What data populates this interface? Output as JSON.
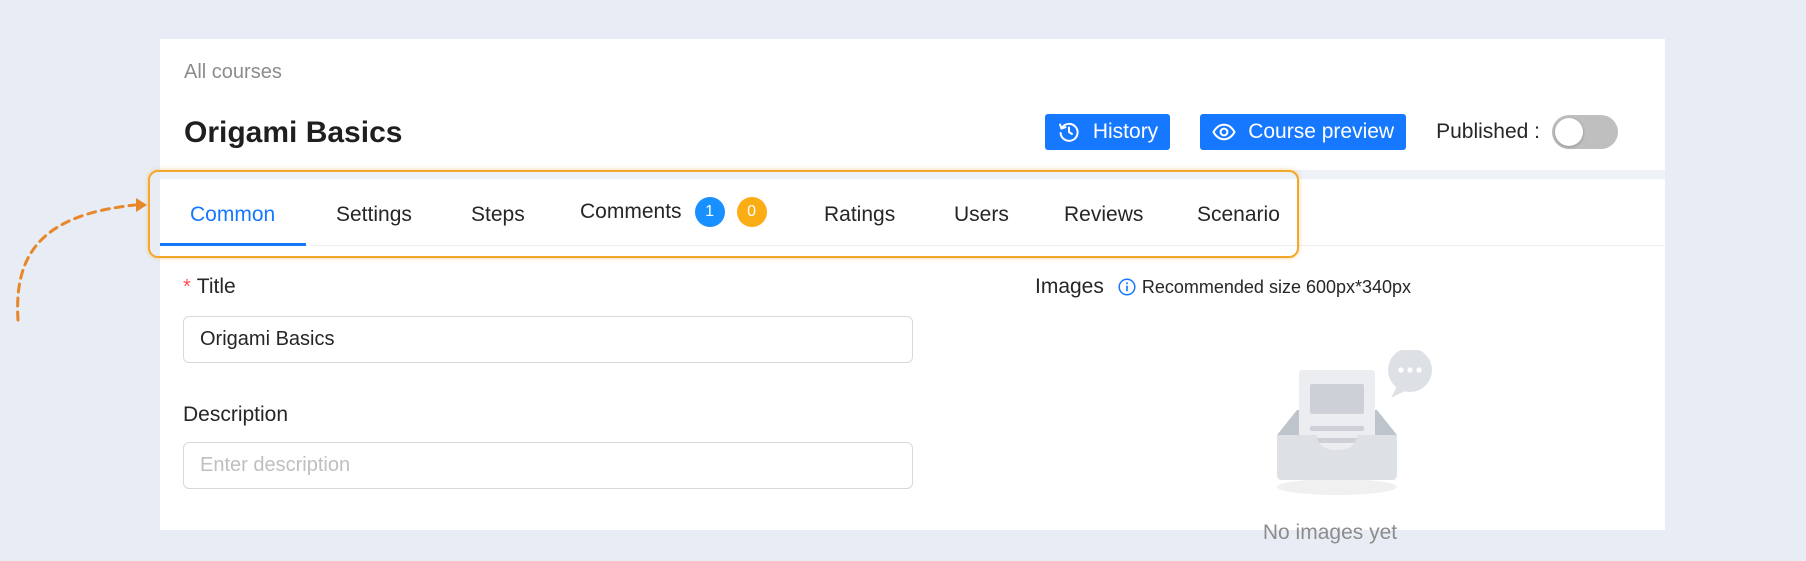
{
  "breadcrumb": "All courses",
  "course": {
    "title": "Origami Basics"
  },
  "header": {
    "history_label": "History",
    "preview_label": "Course preview",
    "published_label": "Published :"
  },
  "tabs": [
    {
      "label": "Common"
    },
    {
      "label": "Settings"
    },
    {
      "label": "Steps"
    },
    {
      "label": "Comments"
    },
    {
      "label": "Ratings"
    },
    {
      "label": "Users"
    },
    {
      "label": "Reviews"
    },
    {
      "label": "Scenario"
    }
  ],
  "comments_badges": {
    "blue": "1",
    "orange": "0"
  },
  "form": {
    "title_label": "Title",
    "title_value": "Origami Basics",
    "description_label": "Description",
    "description_placeholder": "Enter description"
  },
  "images": {
    "label": "Images",
    "hint": "Recommended size 600px*340px",
    "empty_text": "No images yet"
  },
  "colors": {
    "primary": "#1677ff",
    "badge_blue": "#1890ff",
    "badge_orange": "#faad14",
    "highlight": "#f3a82b",
    "background": "#e8edf5"
  },
  "toggle": {
    "published": false
  }
}
